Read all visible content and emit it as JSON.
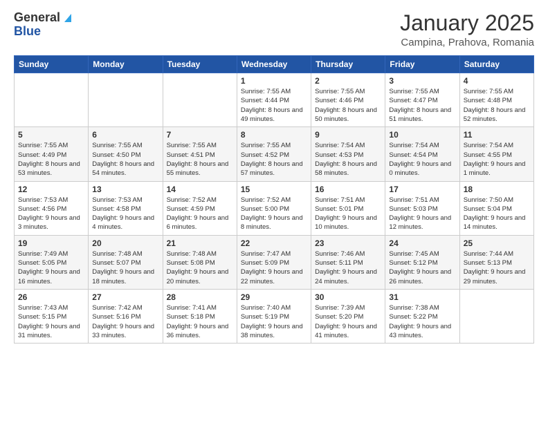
{
  "logo": {
    "line1": "General",
    "line2": "Blue"
  },
  "title": "January 2025",
  "subtitle": "Campina, Prahova, Romania",
  "weekdays": [
    "Sunday",
    "Monday",
    "Tuesday",
    "Wednesday",
    "Thursday",
    "Friday",
    "Saturday"
  ],
  "weeks": [
    [
      {
        "day": "",
        "sunrise": "",
        "sunset": "",
        "daylight": ""
      },
      {
        "day": "",
        "sunrise": "",
        "sunset": "",
        "daylight": ""
      },
      {
        "day": "",
        "sunrise": "",
        "sunset": "",
        "daylight": ""
      },
      {
        "day": "1",
        "sunrise": "Sunrise: 7:55 AM",
        "sunset": "Sunset: 4:44 PM",
        "daylight": "Daylight: 8 hours and 49 minutes."
      },
      {
        "day": "2",
        "sunrise": "Sunrise: 7:55 AM",
        "sunset": "Sunset: 4:46 PM",
        "daylight": "Daylight: 8 hours and 50 minutes."
      },
      {
        "day": "3",
        "sunrise": "Sunrise: 7:55 AM",
        "sunset": "Sunset: 4:47 PM",
        "daylight": "Daylight: 8 hours and 51 minutes."
      },
      {
        "day": "4",
        "sunrise": "Sunrise: 7:55 AM",
        "sunset": "Sunset: 4:48 PM",
        "daylight": "Daylight: 8 hours and 52 minutes."
      }
    ],
    [
      {
        "day": "5",
        "sunrise": "Sunrise: 7:55 AM",
        "sunset": "Sunset: 4:49 PM",
        "daylight": "Daylight: 8 hours and 53 minutes."
      },
      {
        "day": "6",
        "sunrise": "Sunrise: 7:55 AM",
        "sunset": "Sunset: 4:50 PM",
        "daylight": "Daylight: 8 hours and 54 minutes."
      },
      {
        "day": "7",
        "sunrise": "Sunrise: 7:55 AM",
        "sunset": "Sunset: 4:51 PM",
        "daylight": "Daylight: 8 hours and 55 minutes."
      },
      {
        "day": "8",
        "sunrise": "Sunrise: 7:55 AM",
        "sunset": "Sunset: 4:52 PM",
        "daylight": "Daylight: 8 hours and 57 minutes."
      },
      {
        "day": "9",
        "sunrise": "Sunrise: 7:54 AM",
        "sunset": "Sunset: 4:53 PM",
        "daylight": "Daylight: 8 hours and 58 minutes."
      },
      {
        "day": "10",
        "sunrise": "Sunrise: 7:54 AM",
        "sunset": "Sunset: 4:54 PM",
        "daylight": "Daylight: 9 hours and 0 minutes."
      },
      {
        "day": "11",
        "sunrise": "Sunrise: 7:54 AM",
        "sunset": "Sunset: 4:55 PM",
        "daylight": "Daylight: 9 hours and 1 minute."
      }
    ],
    [
      {
        "day": "12",
        "sunrise": "Sunrise: 7:53 AM",
        "sunset": "Sunset: 4:56 PM",
        "daylight": "Daylight: 9 hours and 3 minutes."
      },
      {
        "day": "13",
        "sunrise": "Sunrise: 7:53 AM",
        "sunset": "Sunset: 4:58 PM",
        "daylight": "Daylight: 9 hours and 4 minutes."
      },
      {
        "day": "14",
        "sunrise": "Sunrise: 7:52 AM",
        "sunset": "Sunset: 4:59 PM",
        "daylight": "Daylight: 9 hours and 6 minutes."
      },
      {
        "day": "15",
        "sunrise": "Sunrise: 7:52 AM",
        "sunset": "Sunset: 5:00 PM",
        "daylight": "Daylight: 9 hours and 8 minutes."
      },
      {
        "day": "16",
        "sunrise": "Sunrise: 7:51 AM",
        "sunset": "Sunset: 5:01 PM",
        "daylight": "Daylight: 9 hours and 10 minutes."
      },
      {
        "day": "17",
        "sunrise": "Sunrise: 7:51 AM",
        "sunset": "Sunset: 5:03 PM",
        "daylight": "Daylight: 9 hours and 12 minutes."
      },
      {
        "day": "18",
        "sunrise": "Sunrise: 7:50 AM",
        "sunset": "Sunset: 5:04 PM",
        "daylight": "Daylight: 9 hours and 14 minutes."
      }
    ],
    [
      {
        "day": "19",
        "sunrise": "Sunrise: 7:49 AM",
        "sunset": "Sunset: 5:05 PM",
        "daylight": "Daylight: 9 hours and 16 minutes."
      },
      {
        "day": "20",
        "sunrise": "Sunrise: 7:48 AM",
        "sunset": "Sunset: 5:07 PM",
        "daylight": "Daylight: 9 hours and 18 minutes."
      },
      {
        "day": "21",
        "sunrise": "Sunrise: 7:48 AM",
        "sunset": "Sunset: 5:08 PM",
        "daylight": "Daylight: 9 hours and 20 minutes."
      },
      {
        "day": "22",
        "sunrise": "Sunrise: 7:47 AM",
        "sunset": "Sunset: 5:09 PM",
        "daylight": "Daylight: 9 hours and 22 minutes."
      },
      {
        "day": "23",
        "sunrise": "Sunrise: 7:46 AM",
        "sunset": "Sunset: 5:11 PM",
        "daylight": "Daylight: 9 hours and 24 minutes."
      },
      {
        "day": "24",
        "sunrise": "Sunrise: 7:45 AM",
        "sunset": "Sunset: 5:12 PM",
        "daylight": "Daylight: 9 hours and 26 minutes."
      },
      {
        "day": "25",
        "sunrise": "Sunrise: 7:44 AM",
        "sunset": "Sunset: 5:13 PM",
        "daylight": "Daylight: 9 hours and 29 minutes."
      }
    ],
    [
      {
        "day": "26",
        "sunrise": "Sunrise: 7:43 AM",
        "sunset": "Sunset: 5:15 PM",
        "daylight": "Daylight: 9 hours and 31 minutes."
      },
      {
        "day": "27",
        "sunrise": "Sunrise: 7:42 AM",
        "sunset": "Sunset: 5:16 PM",
        "daylight": "Daylight: 9 hours and 33 minutes."
      },
      {
        "day": "28",
        "sunrise": "Sunrise: 7:41 AM",
        "sunset": "Sunset: 5:18 PM",
        "daylight": "Daylight: 9 hours and 36 minutes."
      },
      {
        "day": "29",
        "sunrise": "Sunrise: 7:40 AM",
        "sunset": "Sunset: 5:19 PM",
        "daylight": "Daylight: 9 hours and 38 minutes."
      },
      {
        "day": "30",
        "sunrise": "Sunrise: 7:39 AM",
        "sunset": "Sunset: 5:20 PM",
        "daylight": "Daylight: 9 hours and 41 minutes."
      },
      {
        "day": "31",
        "sunrise": "Sunrise: 7:38 AM",
        "sunset": "Sunset: 5:22 PM",
        "daylight": "Daylight: 9 hours and 43 minutes."
      },
      {
        "day": "",
        "sunrise": "",
        "sunset": "",
        "daylight": ""
      }
    ]
  ]
}
